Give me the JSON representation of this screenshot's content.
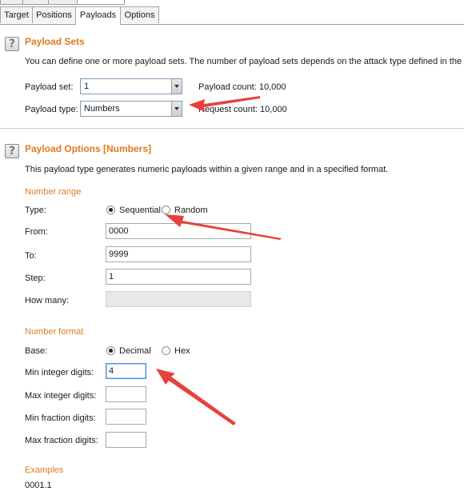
{
  "tabs": [
    "Target",
    "Positions",
    "Payloads",
    "Options"
  ],
  "active_tab": "Payloads",
  "help_icon_glyph": "?",
  "payload_sets": {
    "title": "Payload Sets",
    "description": "You can define one or more payload sets. The number of payload sets depends on the attack type defined in the Positi",
    "payload_set_label": "Payload set:",
    "payload_set_value": "1",
    "payload_type_label": "Payload type:",
    "payload_type_value": "Numbers",
    "payload_count": "Payload count: 10,000",
    "request_count": "Request count: 10,000"
  },
  "payload_options": {
    "title": "Payload Options [Numbers]",
    "description": "This payload type generates numeric payloads within a given range and in a specified format.",
    "number_range_heading": "Number range",
    "type_label": "Type:",
    "sequential_label": "Sequential",
    "random_label": "Random",
    "selected_type": "Sequential",
    "from_label": "From:",
    "from_value": "0000",
    "to_label": "To:",
    "to_value": "9999",
    "step_label": "Step:",
    "step_value": "1",
    "how_many_label": "How many:",
    "how_many_value": "",
    "number_format_heading": "Number format",
    "base_label": "Base:",
    "decimal_label": "Decimal",
    "hex_label": "Hex",
    "selected_base": "Decimal",
    "min_integer_label": "Min integer digits:",
    "min_integer_value": "4",
    "max_integer_label": "Max integer digits:",
    "max_integer_value": "",
    "min_fraction_label": "Min fraction digits:",
    "min_fraction_value": "",
    "max_fraction_label": "Max fraction digits:",
    "max_fraction_value": "",
    "examples_heading": "Examples",
    "example_1": "0001.1"
  },
  "colors": {
    "section_title": "#e07a1f",
    "annotation_arrow": "#e8413c"
  },
  "icons": [
    "help-icon",
    "dropdown-arrow-icon",
    "radio-icon",
    "annotation-arrow"
  ]
}
